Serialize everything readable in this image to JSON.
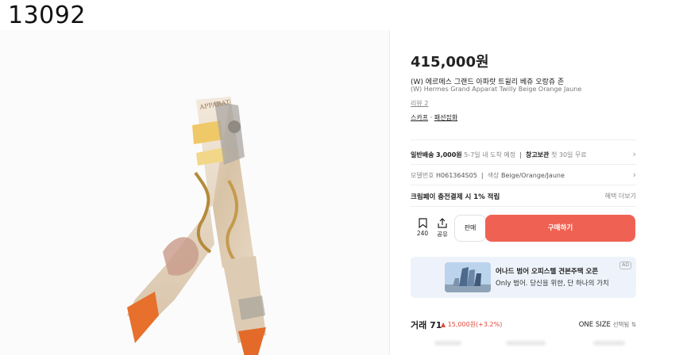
{
  "watermark": "13092",
  "product": {
    "price": "415,000원",
    "title_ko": "(W) 에르메스 그랜드 아파랏 트윌리 베쥬 오랑쥬 존",
    "title_en": "(W) Hermes Grand Apparat Twilly Beige Orange Jaune",
    "review": "리뷰 2",
    "category": "스카프",
    "category_sep": " · ",
    "subcategory": "패션잡화"
  },
  "delivery": {
    "label": "일반배송",
    "fee": "3,000원",
    "eta": "5-7일 내 도착 예정",
    "warehouse_label": "창고보관",
    "warehouse_text": "첫 30일 무료"
  },
  "info": {
    "model_label": "모델번호",
    "model_value": "H061364S05",
    "color_label": "색상",
    "color_value": "Beige/Orange/Jaune"
  },
  "credit": {
    "text": "크림페이 충전결제 시 1% 적립",
    "more": "혜택 더보기"
  },
  "actions": {
    "bookmark_count": "240",
    "share_label": "공유",
    "sell_label": "판매",
    "buy_label": "구매하기"
  },
  "ad": {
    "title": "어나드 범어 오피스텔 견본주택 오픈",
    "subtitle": "Only 범어. 당신을 위한, 단 하나의 가치",
    "badge": "AD"
  },
  "trade": {
    "label": "거래 71",
    "delta": "▲ 15,000원(+3.2%)",
    "size_label": "ONE SIZE",
    "size_select": "선택됨 ⇅"
  },
  "colors": {
    "buy_button": "#ef6253",
    "price_up": "#e0483a",
    "ad_bg": "#eef3fb"
  }
}
